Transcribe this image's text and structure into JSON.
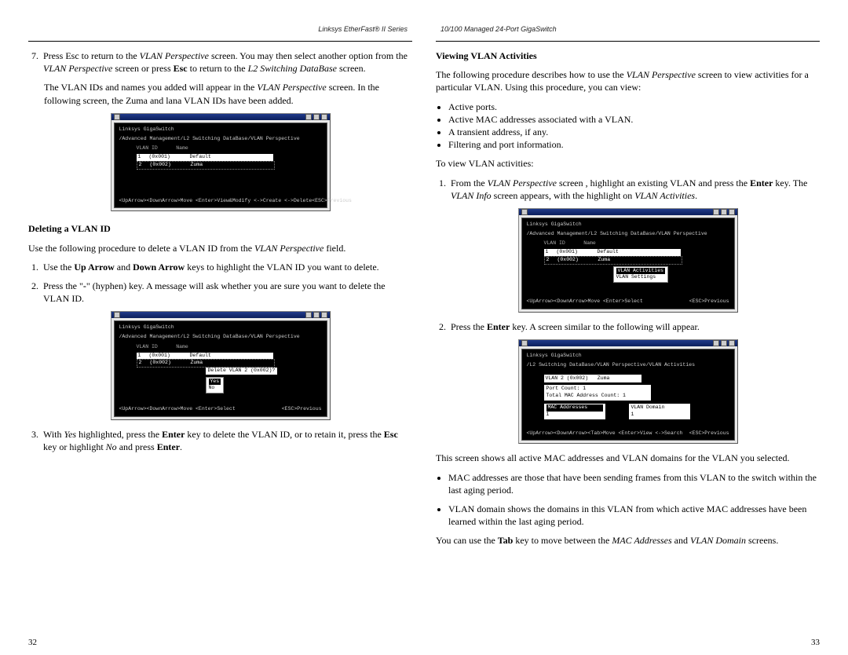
{
  "left": {
    "running_head": "Linksys EtherFast® II Series",
    "step7_n": "7.",
    "step7": "Press Esc to return to the <i>VLAN Perspective</i> screen. You may then select another option from the <i>VLAN Perspective</i> screen or press <b>Esc</b> to return to the <i>L2 Switching DataBase</i> screen.",
    "note": "The VLAN IDs and names you added will appear in the <i>VLAN Perspective</i> screen. In the following screen, the Zuma and lana VLAN IDs have been added.",
    "del_title": "Deleting a VLAN ID",
    "del_intro": "Use the following procedure to delete a VLAN ID from the <i>VLAN Perspective</i> field.",
    "del1_n": "1.",
    "del1": "Use the <b>Up Arrow</b> and <b>Down Arrow</b> keys to highlight the VLAN ID you want to delete.",
    "del2_n": "2.",
    "del2": "Press the \"<b>-</b>\" (hyphen) key. A message will ask whether you are sure you want to delete the VLAN ID.",
    "del3_n": "3.",
    "del3": "With <i>Yes</i> highlighted, press the <b>Enter</b> key to delete the VLAN ID, or to retain it, press the <b>Esc</b> key or highlight <i>No</i> and press <b>Enter</b>.",
    "folio": "32",
    "shot1": {
      "hdr1": "Linksys GigaSwitch",
      "hdr2": "/Advanced Management/L2 Switching DataBase/VLAN Perspective",
      "col_h": "VLAN ID      Name",
      "rows": [
        {
          "n": "1",
          "id": "(0x001)",
          "name": "Default"
        },
        {
          "n": "2",
          "id": "(0x002)",
          "name": "Zuma"
        }
      ],
      "ftr_l": "<UpArrow><DownArrow>Move  <Enter>View&Modify  <->Create  <->Delete",
      "ftr_r": "<ESC>Previous"
    },
    "shot2": {
      "hdr1": "Linksys GigaSwitch",
      "hdr2": "/Advanced Management/L2 Switching DataBase/VLAN Perspective",
      "col_h": "VLAN ID      Name",
      "rows": [
        {
          "n": "1",
          "id": "(0x001)",
          "name": "Default"
        },
        {
          "n": "2",
          "id": "(0x002)",
          "name": "Zuma"
        }
      ],
      "popup": "Delete VLAN 2 (0x002)?",
      "opts": [
        "Yes",
        "No"
      ],
      "ftr_l": "<UpArrow><DownArrow>Move  <Enter>Select",
      "ftr_r": "<ESC>Previous"
    }
  },
  "right": {
    "running_head": "10/100 Managed 24-Port GigaSwitch",
    "view_title": "Viewing VLAN Activities",
    "intro": "The following procedure describes how to use the <i>VLAN Perspective</i> screen to view activities for a particular VLAN. Using this procedure, you can view:",
    "bullets": [
      "Active ports.",
      "Active MAC addresses associated with a VLAN.",
      "A transient address, if any.",
      "Filtering and port information."
    ],
    "to_view": "To view VLAN activities:",
    "v1_n": "1.",
    "v1": "From the <i>VLAN Perspective</i> screen , highlight an existing VLAN and press the <b>Enter</b> key. The <i>VLAN Info</i> screen appears, with the highlight on <i>VLAN Activities</i>.",
    "v2_n": "2.",
    "v2": "Press the <b>Enter</b> key. A screen similar to the following will appear.",
    "after_shot": "This screen shows all active MAC addresses and VLAN domains for the VLAN you selected.",
    "bullets2": [
      "MAC addresses are those that have been sending frames from this VLAN to the switch within the last aging period.",
      "VLAN domain shows the domains in this VLAN from which active MAC addresses have been learned within the last aging period."
    ],
    "tab_note": "You can use the <b>Tab</b> key to move between the <i>MAC Addresses</i> and <i>VLAN Domain</i> screens.",
    "folio": "33",
    "shot3": {
      "hdr1": "Linksys GigaSwitch",
      "hdr2": "/Advanced Management/L2 Switching DataBase/VLAN Perspective",
      "col_h": "VLAN ID      Name",
      "rows": [
        {
          "n": "1",
          "id": "(0x001)",
          "name": "Default"
        },
        {
          "n": "2",
          "id": "(0x002)",
          "name": "Zuma"
        }
      ],
      "menu": [
        "VLAN Activities",
        "VLAN Settings"
      ],
      "ftr_l": "<UpArrow><DownArrow>Move  <Enter>Select",
      "ftr_r": "<ESC>Previous"
    },
    "shot4": {
      "hdr1": "Linksys GigaSwitch",
      "hdr2": "/L2 Switching DataBase/VLAN Perspective/VLAN Activities",
      "vlan_line": "VLAN 2 (0x002)   Zuma",
      "stats": [
        "Port Count: 1",
        "Total MAC Address Count: 1"
      ],
      "box_l_title": "MAC Addresses",
      "box_r_title": "VLAN Domain",
      "box_l_row": "1",
      "box_r_row": "1",
      "ftr_l": "<UpArrow><DownArrow><Tab>Move  <Enter>View  <->Search",
      "ftr_r": "<ESC>Previous"
    }
  }
}
